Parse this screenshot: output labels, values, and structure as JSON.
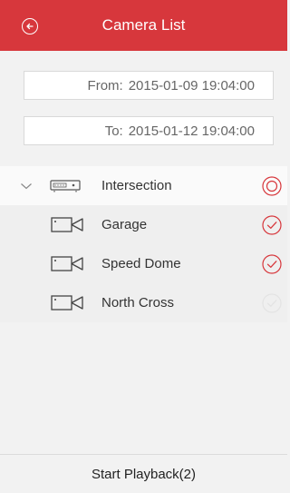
{
  "header": {
    "title": "Camera List",
    "back_icon": "back-circle-icon",
    "color": "#d7373c"
  },
  "date_range": {
    "from_label": "From:",
    "from_value": "2015-01-09 19:04:00",
    "to_label": "To:",
    "to_value": "2015-01-12 19:04:00"
  },
  "devices": [
    {
      "name": "Intersection",
      "expanded": true,
      "selection": "partial",
      "cameras": [
        {
          "name": "Garage",
          "checked": true
        },
        {
          "name": "Speed Dome",
          "checked": true
        },
        {
          "name": "North Cross",
          "checked": false
        }
      ]
    }
  ],
  "footer": {
    "action_label": "Start Playback(2)"
  },
  "colors": {
    "accent": "#d7373c",
    "unchecked": "#e6e6e6"
  }
}
